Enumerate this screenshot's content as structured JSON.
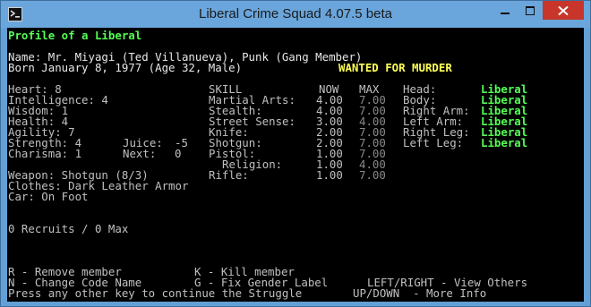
{
  "window": {
    "title": "Liberal Crime Squad 4.07.5 beta"
  },
  "header": {
    "heading": "Profile of a Liberal",
    "name_line": "Name: Mr. Miyagi (Ted Villanueva), Punk (Gang Member)",
    "born_line": "Born January 8, 1977 (Age 32, Male)",
    "wanted": "WANTED FOR MURDER"
  },
  "stats": [
    "Heart: 8",
    "Intelligence: 4",
    "Wisdom: 1",
    "Health: 4",
    "Agility: 7",
    "Strength: 4",
    "Charisma: 1"
  ],
  "juice": {
    "label": "Juice:",
    "value": "-5"
  },
  "next": {
    "label": "Next:",
    "value": "0"
  },
  "skills": {
    "header_skill": "SKILL",
    "header_now": "NOW",
    "header_max": "MAX",
    "rows": [
      {
        "name": "Martial Arts:",
        "now": "4.00",
        "max": "7.00"
      },
      {
        "name": "Stealth:",
        "now": "4.00",
        "max": "7.00"
      },
      {
        "name": "Street Sense:",
        "now": "3.00",
        "max": "4.00"
      },
      {
        "name": "Knife:",
        "now": "2.00",
        "max": "7.00"
      },
      {
        "name": "Shotgun:",
        "now": "2.00",
        "max": "7.00"
      },
      {
        "name": "Pistol:",
        "now": "1.00",
        "max": "7.00"
      },
      {
        "name": "Religion:",
        "now": "1.00",
        "max": "4.00"
      },
      {
        "name": "Rifle:",
        "now": "1.00",
        "max": "7.00"
      }
    ]
  },
  "body": [
    {
      "part": "Head:",
      "status": "Liberal"
    },
    {
      "part": "Body:",
      "status": "Liberal"
    },
    {
      "part": "Right Arm:",
      "status": "Liberal"
    },
    {
      "part": "Left Arm:",
      "status": "Liberal"
    },
    {
      "part": "Right Leg:",
      "status": "Liberal"
    },
    {
      "part": "Left Leg:",
      "status": "Liberal"
    }
  ],
  "equipment": {
    "weapon": "Weapon: Shotgun (8/3)",
    "clothes": "Clothes: Dark Leather Armor",
    "car": "Car: On Foot"
  },
  "recruits": "0 Recruits / 0 Max",
  "commands": {
    "remove": "R - Remove member",
    "kill": "K - Kill member",
    "code_name": "N - Change Code Name",
    "gender": "G - Fix Gender Label",
    "view_others": "LEFT/RIGHT - View Others",
    "continue": "Press any other key to continue the Struggle",
    "more_info": "UP/DOWN  - More Info"
  },
  "colors": {
    "liberal": "#55ff55",
    "wanted": "#ffff55",
    "console_bg": "#000000",
    "close_button": "#c7352b"
  }
}
